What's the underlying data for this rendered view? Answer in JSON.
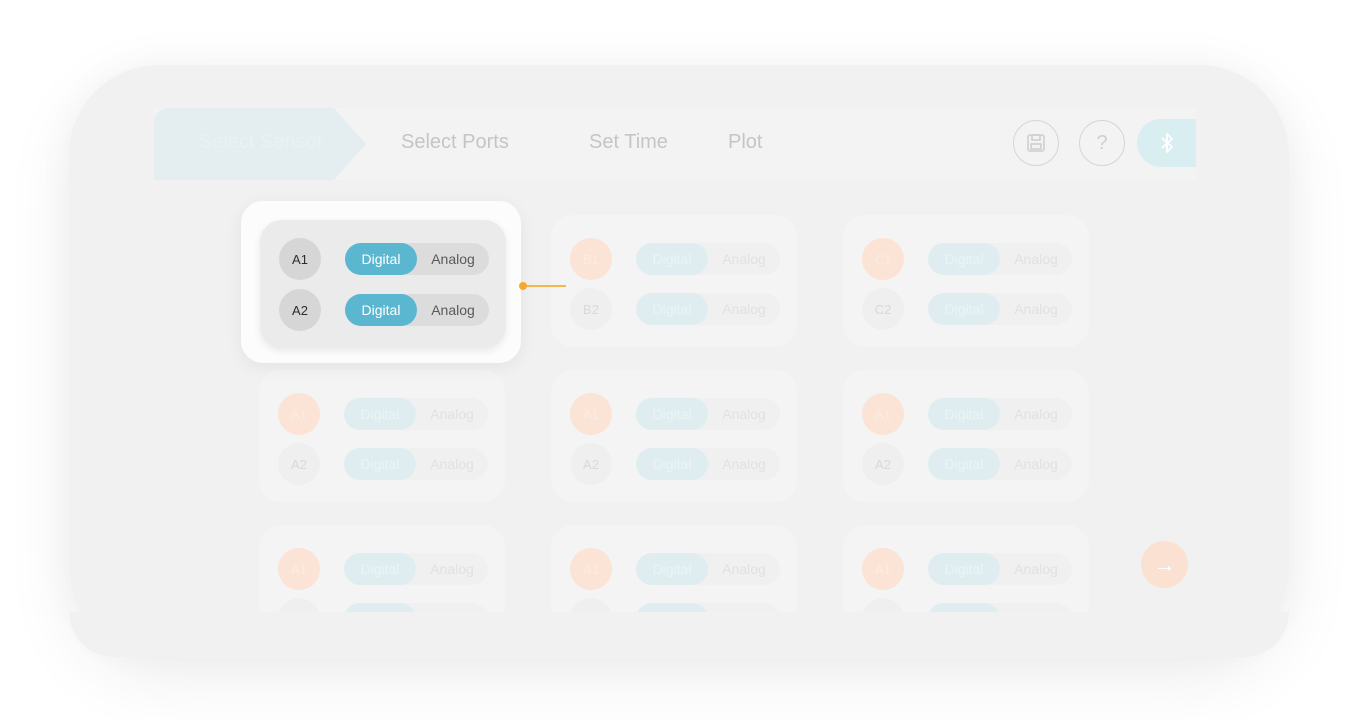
{
  "steps": [
    "Select Sensor",
    "Select Ports",
    "Set Time",
    "Plot"
  ],
  "icons": {
    "save": "save-icon",
    "help": "?",
    "bluetooth": "bluetooth-icon",
    "next": "→"
  },
  "focus_panel": {
    "rows": [
      {
        "port": "A1",
        "digital": "Digital",
        "analog": "Analog"
      },
      {
        "port": "A2",
        "digital": "Digital",
        "analog": "Analog"
      }
    ]
  },
  "panels": [
    {
      "rows": [
        {
          "port": "B1",
          "digital": "Digital",
          "analog": "Analog"
        },
        {
          "port": "B2",
          "digital": "Digital",
          "analog": "Analog"
        }
      ]
    },
    {
      "rows": [
        {
          "port": "C1",
          "digital": "Digital",
          "analog": "Analog"
        },
        {
          "port": "C2",
          "digital": "Digital",
          "analog": "Analog"
        }
      ]
    },
    {
      "rows": [
        {
          "port": "A1",
          "digital": "Digital",
          "analog": "Analog"
        },
        {
          "port": "A2",
          "digital": "Digital",
          "analog": "Analog"
        }
      ]
    },
    {
      "rows": [
        {
          "port": "A1",
          "digital": "Digital",
          "analog": "Analog"
        },
        {
          "port": "A2",
          "digital": "Digital",
          "analog": "Analog"
        }
      ]
    },
    {
      "rows": [
        {
          "port": "A1",
          "digital": "Digital",
          "analog": "Analog"
        },
        {
          "port": "A2",
          "digital": "Digital",
          "analog": "Analog"
        }
      ]
    },
    {
      "rows": [
        {
          "port": "A1",
          "digital": "Digital",
          "analog": "Analog"
        }
      ]
    },
    {
      "rows": [
        {
          "port": "A1",
          "digital": "Digital",
          "analog": "Analog"
        }
      ]
    },
    {
      "rows": [
        {
          "port": "A1",
          "digital": "Digital",
          "analog": "Analog"
        }
      ]
    }
  ],
  "colors": {
    "accent": "#5bb7d0",
    "connector": "#f7b64a",
    "port_warm": "#fbe3d6"
  }
}
